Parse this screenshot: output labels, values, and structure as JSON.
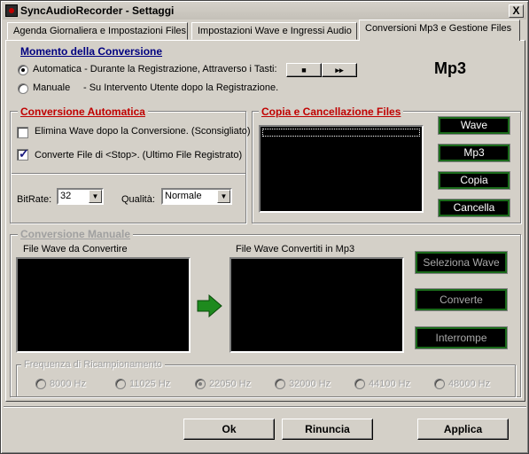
{
  "window": {
    "title": "SyncAudioRecorder - Settaggi",
    "close_glyph": "X"
  },
  "tabs": [
    {
      "label": "Agenda Giornaliera e Impostazioni Files"
    },
    {
      "label": "Impostazioni Wave e Ingressi Audio"
    },
    {
      "label": "Conversioni Mp3 e Gestione Files"
    }
  ],
  "momento": {
    "title": "Momento della Conversione",
    "automatica_label": "Automatica - Durante la Registrazione, Attraverso i Tasti:",
    "manuale_label": "Manuale",
    "manuale_desc": "- Su Intervento Utente dopo la Registrazione.",
    "stop_glyph": "■",
    "next_glyph": "▸▸",
    "format_label": "Mp3"
  },
  "conversione_automatica": {
    "title": "Conversione Automatica",
    "elimina_wave_label": "Elimina Wave dopo la Conversione. (Sconsigliato)",
    "converte_label": "Converte File di <Stop>.  (Ultimo File Registrato)",
    "bitrate_label": "BitRate:",
    "bitrate_value": "32",
    "qualita_label": "Qualità:",
    "qualita_value": "Normale"
  },
  "copia": {
    "title": "Copia e Cancellazione Files",
    "buttons": [
      "Wave",
      "Mp3",
      "Copia",
      "Cancella"
    ]
  },
  "conversione_manuale": {
    "title": "Conversione Manuale",
    "wave_list_label": "File Wave da Convertire",
    "mp3_list_label": "File Wave Convertiti in Mp3",
    "seleziona_label": "Seleziona Wave",
    "converte_label": "Converte",
    "interrompe_label": "Interrompe"
  },
  "frequenza": {
    "title": "Frequenza di Ricampionamento",
    "options": [
      "8000 Hz",
      "11025 Hz",
      "22050 Hz",
      "32000 Hz",
      "44100 Hz",
      "48000 Hz"
    ],
    "selected": "22050 Hz"
  },
  "footer": {
    "ok_label": "Ok",
    "rinuncia_label": "Rinuncia",
    "applica_label": "Applica"
  },
  "colors": {
    "accent_red": "#c00000",
    "accent_blue": "#000080",
    "button_green": "#1a6a1a",
    "arrow_green": "#1e8a1e"
  }
}
